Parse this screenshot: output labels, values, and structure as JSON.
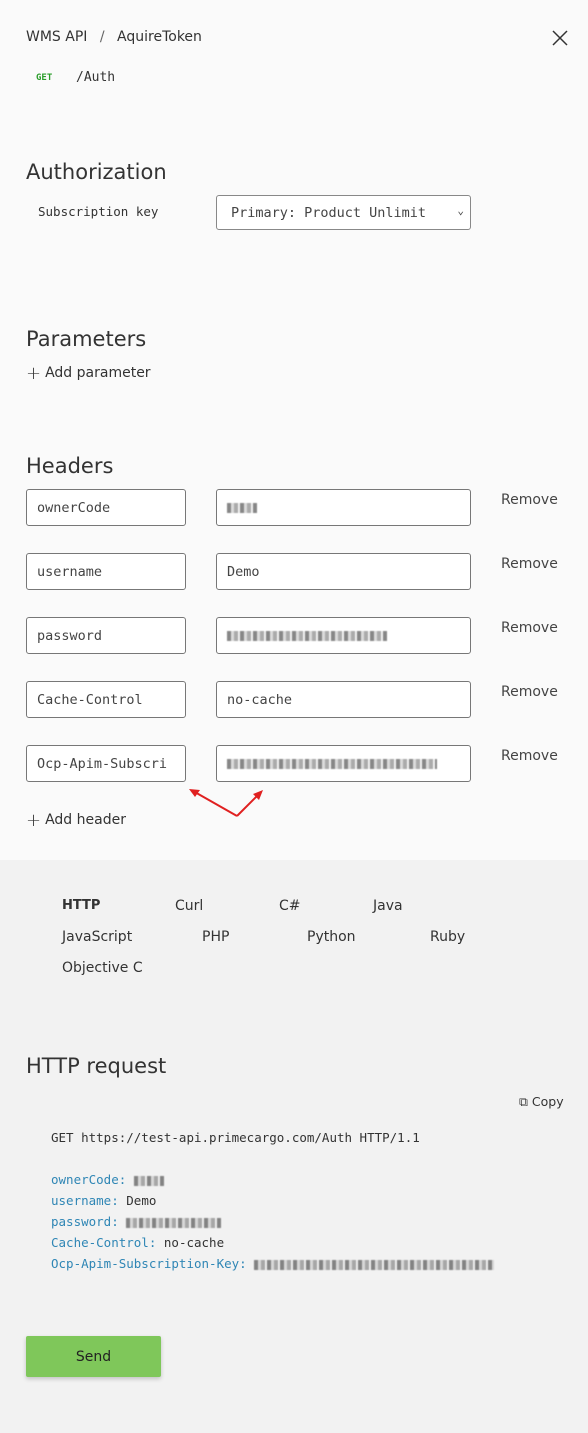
{
  "breadcrumb": {
    "api": "WMS API",
    "separator": "/",
    "operation": "AquireToken"
  },
  "method": "GET",
  "path": "/Auth",
  "authorization": {
    "title": "Authorization",
    "label": "Subscription key",
    "selected": "Primary: Product Unlimit"
  },
  "parameters": {
    "title": "Parameters",
    "add_label": "Add parameter"
  },
  "headers": {
    "title": "Headers",
    "remove_label": "Remove",
    "add_label": "Add header",
    "rows": [
      {
        "name": "ownerCode",
        "value": "",
        "redacted": true
      },
      {
        "name": "username",
        "value": "Demo",
        "redacted": false
      },
      {
        "name": "password",
        "value": "",
        "redacted": true
      },
      {
        "name": "Cache-Control",
        "value": "no-cache",
        "redacted": false
      },
      {
        "name": "Ocp-Apim-Subscri",
        "value": "",
        "redacted": true
      }
    ]
  },
  "languages": [
    "HTTP",
    "Curl",
    "C#",
    "Java",
    "JavaScript",
    "PHP",
    "Python",
    "Ruby",
    "Objective C"
  ],
  "active_language": "HTTP",
  "request": {
    "title": "HTTP request",
    "copy_label": "Copy",
    "line": "GET https://test-api.primecargo.com/Auth HTTP/1.1",
    "headers": [
      {
        "key": "ownerCode:",
        "value": "",
        "redacted": true
      },
      {
        "key": "username:",
        "value": "Demo",
        "redacted": false
      },
      {
        "key": "password:",
        "value": "",
        "redacted": true
      },
      {
        "key": "Cache-Control:",
        "value": "no-cache",
        "redacted": false
      },
      {
        "key": "Ocp-Apim-Subscription-Key:",
        "value": "",
        "redacted": true
      }
    ]
  },
  "send_label": "Send",
  "colors": {
    "method_get": "#2a9d2a",
    "send_button": "#7fc75a",
    "header_key": "#2f86b5",
    "annotation_arrow": "#e02020"
  }
}
